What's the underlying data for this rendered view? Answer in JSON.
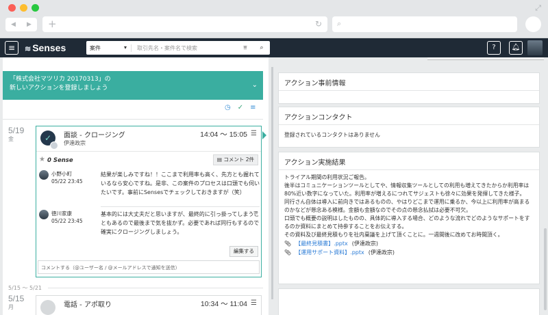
{
  "browser": {
    "nav_back": "◀",
    "nav_forward": "▶",
    "new_tab": "+",
    "reload": "↻",
    "search_glyph": "⌕"
  },
  "header": {
    "logo": "Senses",
    "search_category": "案件",
    "search_placeholder": "取引先名・案件名で検索"
  },
  "left": {
    "banner_line1": "「株式会社マツリカ 20170313」の",
    "banner_line2": "新しいアクションを登録しましょう",
    "timeline": [
      {
        "date": "5/19",
        "dow": "金",
        "title": "面談 - クロージング",
        "user": "伊達政宗",
        "time": "14:04 ～ 15:05",
        "sense": "0 Sense",
        "comment_button": "コメント 2件",
        "comments": [
          {
            "name": "小野小町",
            "date": "05/22 23:45",
            "text": "結果が楽しみですね！！ここまで利用率も高く、先方とも握れているなら安心ですね。是非、この案件のプロセスは口頭でも伺いたいです。事前にSensesでチェックしておきますが（笑）"
          },
          {
            "name": "徳川家康",
            "date": "05/22 23:45",
            "text": "基本的には大丈夫だと思いますが、最終的に引っ掛ってしまうこともあるので最後まで気を抜かず。必要であれば同行もするので確実にクロージングしましょう。"
          }
        ],
        "edit_button": "編集する",
        "comment_placeholder": "コメントする（@ユーザー名 / @メールアドレスで通知を送信）"
      }
    ],
    "range": "5/15 ～ 5/21",
    "timeline2": {
      "date": "5/15",
      "dow": "月",
      "title": "電話 - アポ取り",
      "time": "10:34 ～ 11:04"
    }
  },
  "right": {
    "pre_info_title": "アクション事前情報",
    "contact_title": "アクションコンタクト",
    "contact_empty": "登録されているコンタクトはありません",
    "result_title": "アクション実施結果",
    "result_lines": [
      "トライアル期間の利用状況ご報告。",
      "後半はコミュニケーションツールとしてや、情報収集ツールとしての利用も増えてきたからか利用率は80%近い数字になっていた。利用率が増えるにつれてサジェストも徐々に効果を発揮してきた様子。",
      "同行さん自体は導入に前向きではあるものの、やはりどこまで運用に乗るか、今以上に利用率が高まるのかなどが懸念ある模様。金額も金額なのでその点の懸念払拭は必要不可欠。",
      "口頭でも概要の説明はしたものの、具体的に導入する場合、どのような流れでどのようなサポートをするのか資料にまとめて持参することをお伝えする。",
      "その資料及び最終見積もりを社内稟議を上げて頂くことに。一週間後に改めてお時間頂く。"
    ],
    "files": [
      {
        "name": "【最終見積書】.pptx",
        "owner": "(伊達政宗)"
      },
      {
        "name": "【運用サポート資料】.pptx",
        "owner": "(伊達政宗)"
      }
    ]
  }
}
